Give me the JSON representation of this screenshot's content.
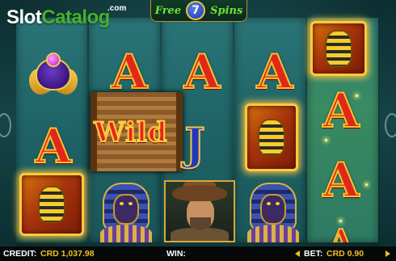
{
  "logo": {
    "part1": "Slot",
    "part2": "Catalog",
    "suffix": ".com"
  },
  "banner": {
    "word1": "Free",
    "count": "7",
    "word2": "Spins"
  },
  "reels": {
    "wild_label": "Wild",
    "letter_a": "A",
    "letter_j": "J"
  },
  "status": {
    "credit_label": "CREDIT:",
    "credit_value": "CRD 1,037.98",
    "win_label": "WIN:",
    "win_value": "",
    "bet_label": "BET:",
    "bet_value": "CRD 0.90"
  },
  "colors": {
    "accent_gold": "#f0c21a",
    "logo_green": "#48b12a",
    "banner_green": "#6fe03a"
  }
}
